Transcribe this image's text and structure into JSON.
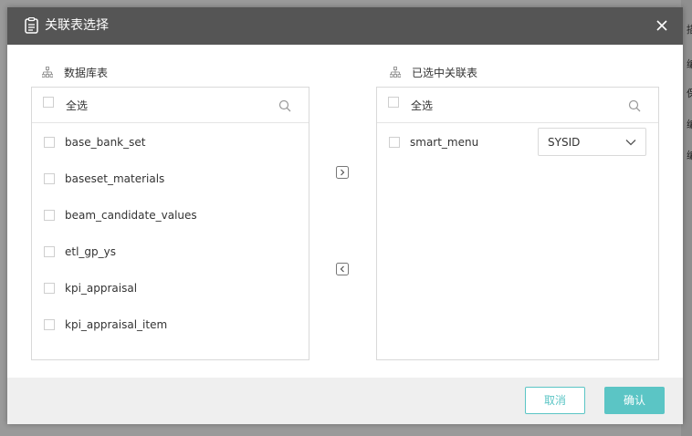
{
  "background": {
    "right_edge_glyphs": [
      "描",
      "编",
      "保",
      "编",
      "编"
    ]
  },
  "dialog": {
    "title": "关联表选择",
    "icons": {
      "title": "clipboard-icon",
      "close": "close-icon"
    }
  },
  "left_panel": {
    "title": "数据库表",
    "select_all_label": "全选",
    "items": [
      "base_bank_set",
      "baseset_materials",
      "beam_candidate_values",
      "etl_gp_ys",
      "kpi_appraisal",
      "kpi_appraisal_item"
    ]
  },
  "right_panel": {
    "title": "已选中关联表",
    "select_all_label": "全选",
    "items": [
      {
        "name": "smart_menu",
        "field": "SYSID"
      }
    ]
  },
  "transfer": {
    "move_right_icon": "chevron-right-icon",
    "move_left_icon": "chevron-left-icon"
  },
  "footer": {
    "cancel_label": "取消",
    "confirm_label": "确认"
  },
  "colors": {
    "header_bg": "#555555",
    "accent": "#5bc5c5",
    "footer_bg": "#efefef"
  }
}
